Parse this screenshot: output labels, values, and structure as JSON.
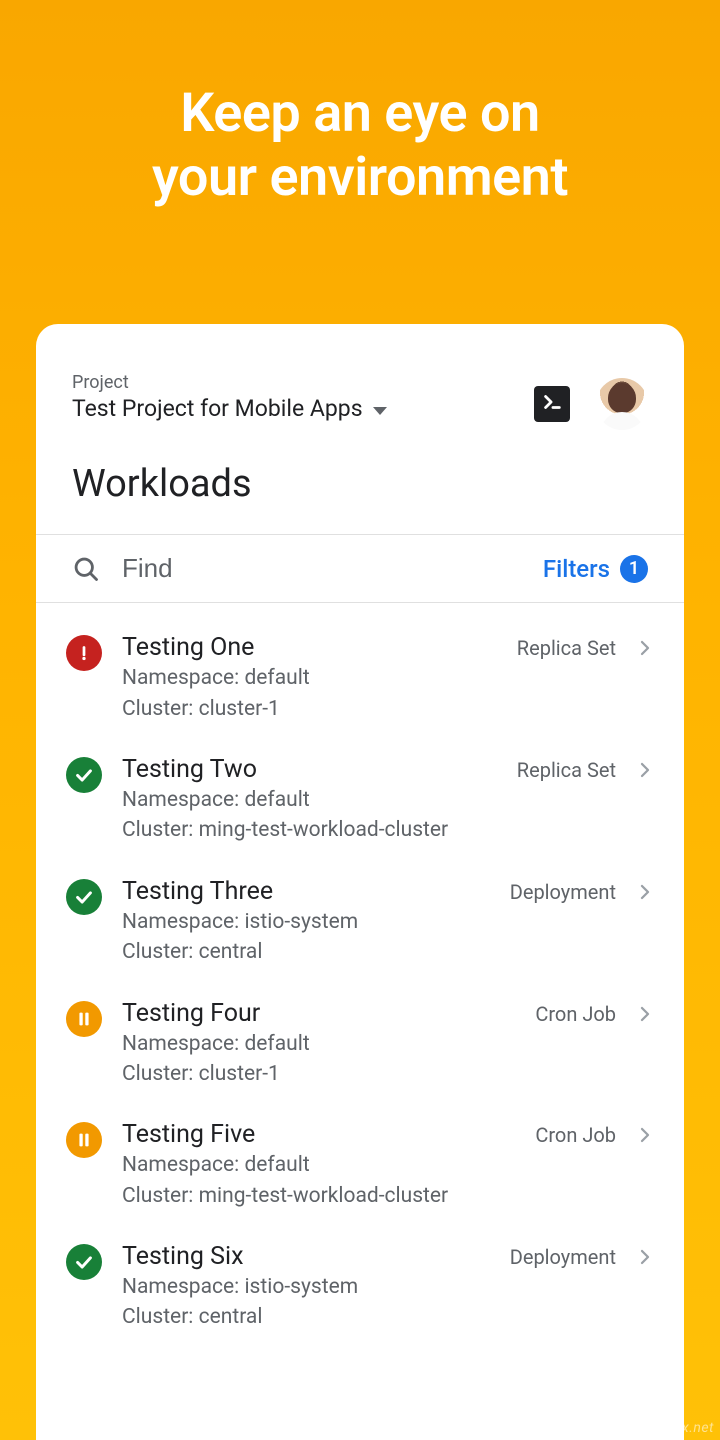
{
  "hero": {
    "line1": "Keep an eye on",
    "line2": "your environment"
  },
  "header": {
    "project_label": "Project",
    "project_name": "Test Project for Mobile Apps"
  },
  "page_title": "Workloads",
  "search": {
    "placeholder": "Find",
    "filters_label": "Filters",
    "filter_count": "1"
  },
  "labels": {
    "namespace_prefix": "Namespace: ",
    "cluster_prefix": "Cluster: "
  },
  "workloads": [
    {
      "status": "error",
      "name": "Testing One",
      "type": "Replica Set",
      "namespace": "default",
      "cluster": "cluster-1"
    },
    {
      "status": "ok",
      "name": "Testing Two",
      "type": "Replica Set",
      "namespace": "default",
      "cluster": "ming-test-workload-cluster"
    },
    {
      "status": "ok",
      "name": "Testing Three",
      "type": "Deployment",
      "namespace": "istio-system",
      "cluster": "central"
    },
    {
      "status": "pause",
      "name": "Testing Four",
      "type": "Cron Job",
      "namespace": "default",
      "cluster": "cluster-1"
    },
    {
      "status": "pause",
      "name": "Testing Five",
      "type": "Cron Job",
      "namespace": "default",
      "cluster": "ming-test-workload-cluster"
    },
    {
      "status": "ok",
      "name": "Testing Six",
      "type": "Deployment",
      "namespace": "istio-system",
      "cluster": "central"
    }
  ],
  "watermark": "www.kkx.net"
}
